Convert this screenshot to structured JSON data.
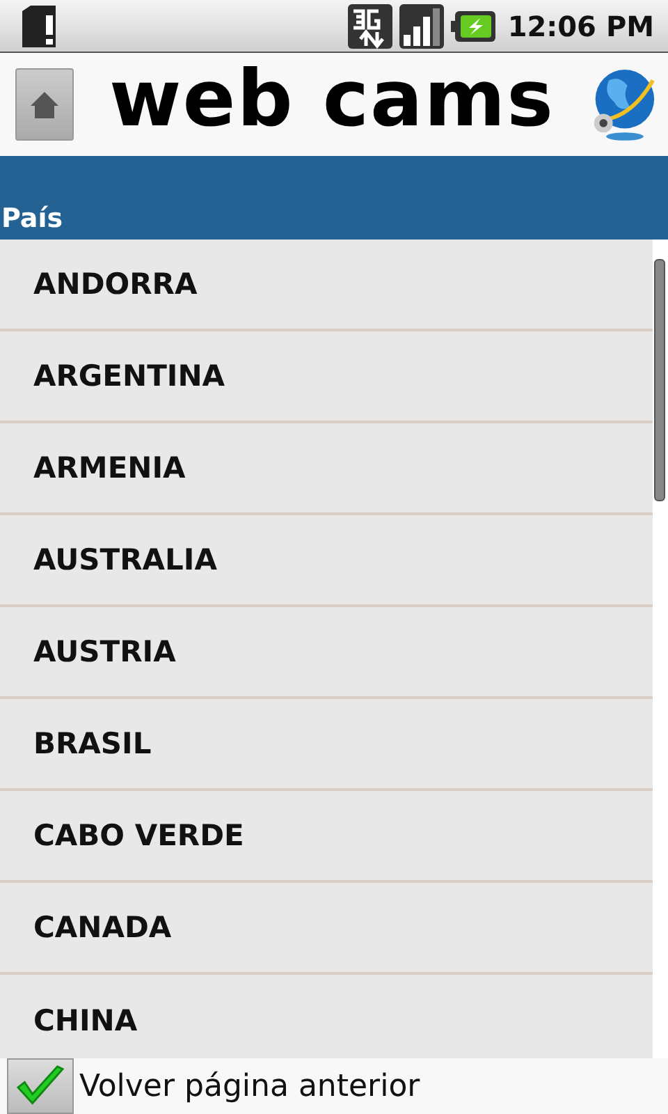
{
  "status_bar": {
    "time": "12:06 PM"
  },
  "header": {
    "title": "web cams"
  },
  "section": {
    "title": "País"
  },
  "countries": [
    "ANDORRA",
    "ARGENTINA",
    "ARMENIA",
    "AUSTRALIA",
    "AUSTRIA",
    "BRASIL",
    "CABO VERDE",
    "CANADA",
    "CHINA"
  ],
  "footer": {
    "label": "Volver página anterior"
  }
}
